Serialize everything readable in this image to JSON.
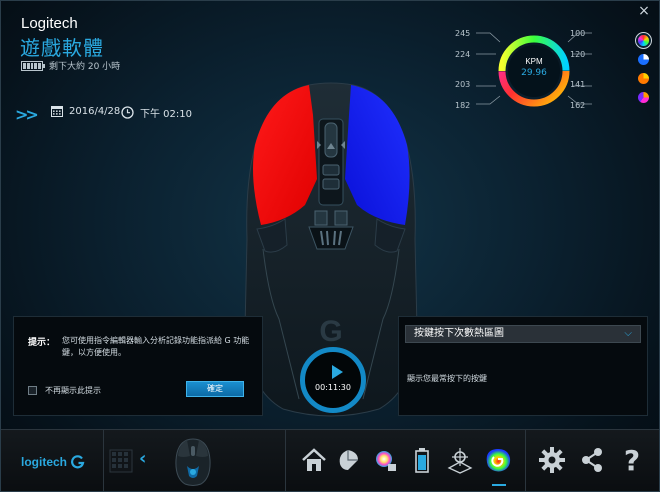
{
  "header": {
    "brand": "Logitech",
    "title": "遊戲軟體",
    "battery_text": "剩下大約 20 小時",
    "close_label": "×"
  },
  "session": {
    "date": "2016/4/28",
    "time": "下午 02:10"
  },
  "kpm": {
    "title": "KPM",
    "value": "29.96",
    "ticks_left": [
      "245",
      "224",
      "203",
      "182"
    ],
    "ticks_right": [
      "100",
      "120",
      "141",
      "162"
    ]
  },
  "tip": {
    "label": "提示：",
    "text": "您可使用指令編輯器輸入分析記錄功能指派給 G 功能鍵，以方便使用。",
    "checkbox_label": "不再顯示此提示",
    "ok_label": "確定"
  },
  "timer": {
    "elapsed": "00:11:30"
  },
  "heatmap": {
    "selected": "按鍵按下次數熱區圖",
    "description": "顯示您最常按下的按鍵"
  },
  "footer": {
    "logo_text": "logitech"
  },
  "colors": {
    "accent": "#2aa9e0",
    "left_button": "#ff0000",
    "right_button": "#1020ff"
  }
}
